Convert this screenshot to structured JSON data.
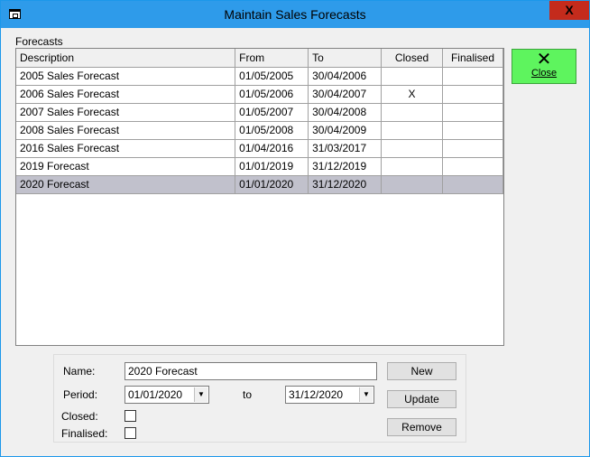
{
  "window": {
    "title": "Maintain Sales Forecasts",
    "close_glyph": "X"
  },
  "group_label": "Forecasts",
  "grid": {
    "columns": [
      "Description",
      "From",
      "To",
      "Closed",
      "Finalised"
    ],
    "rows": [
      [
        "2005 Sales Forecast",
        "01/05/2005",
        "30/04/2006",
        "",
        ""
      ],
      [
        "2006 Sales Forecast",
        "01/05/2006",
        "30/04/2007",
        "X",
        ""
      ],
      [
        "2007 Sales Forecast",
        "01/05/2007",
        "30/04/2008",
        "",
        ""
      ],
      [
        "2008 Sales Forecast",
        "01/05/2008",
        "30/04/2009",
        "",
        ""
      ],
      [
        "2016 Sales Forecast",
        "01/04/2016",
        "31/03/2017",
        "",
        ""
      ],
      [
        "2019 Forecast",
        "01/01/2019",
        "31/12/2019",
        "",
        ""
      ],
      [
        "2020 Forecast",
        "01/01/2020",
        "31/12/2020",
        "",
        ""
      ]
    ],
    "selected_row": 6
  },
  "close_button": {
    "glyph": "✕",
    "label": "Close"
  },
  "form": {
    "name_label": "Name:",
    "name_value": "2020 Forecast",
    "period_label": "Period:",
    "period_from": "01/01/2020",
    "to_label": "to",
    "period_to": "31/12/2020",
    "closed_label": "Closed:",
    "finalised_label": "Finalised:",
    "closed_checked": false,
    "finalised_checked": false
  },
  "buttons": {
    "new": "New",
    "update": "Update",
    "remove": "Remove"
  },
  "colors": {
    "titlebar": "#2e9bea",
    "close_x": "#c42b1c",
    "close_button": "#5ef45e",
    "selected_row": "#c1c1cc"
  }
}
